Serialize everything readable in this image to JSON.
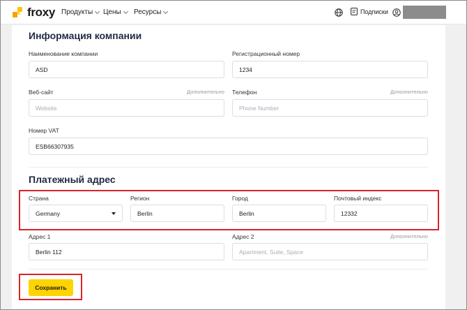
{
  "brand": {
    "name": "froxy"
  },
  "nav": {
    "items": [
      {
        "label": "Продукты"
      },
      {
        "label": "Цены"
      },
      {
        "label": "Ресурсы"
      }
    ],
    "subscriptions_label": "Подписки"
  },
  "company": {
    "heading": "Информация компании",
    "name": {
      "label": "Наименование компании",
      "value": "ASD"
    },
    "reg": {
      "label": "Регистрационный номер",
      "value": "1234"
    },
    "website": {
      "label": "Веб-сайт",
      "optional": "Дополнительно",
      "placeholder": "Website"
    },
    "phone": {
      "label": "Телефон",
      "optional": "Дополнительно",
      "placeholder": "Phone Number"
    },
    "vat": {
      "label": "Номер VAT",
      "value": "ESB66307935"
    }
  },
  "billing": {
    "heading": "Платежный адрес",
    "country": {
      "label": "Страна",
      "value": "Germany"
    },
    "region": {
      "label": "Регион",
      "value": "Berlin"
    },
    "city": {
      "label": "Город",
      "value": "Berlin"
    },
    "zip": {
      "label": "Почтовый индекс",
      "value": "12332"
    },
    "address1": {
      "label": "Адрес 1",
      "value": "Berlin 112"
    },
    "address2": {
      "label": "Адрес 2",
      "optional": "Дополнительно",
      "placeholder": "Apartment, Suite, Space"
    }
  },
  "actions": {
    "save_label": "Сохранить"
  },
  "colors": {
    "accent": "#ffd400",
    "highlight": "#d8232a",
    "heading": "#1f2a44"
  }
}
